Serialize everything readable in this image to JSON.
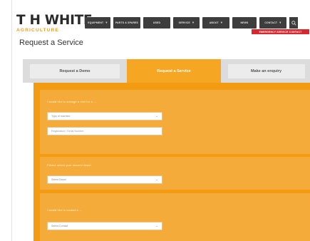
{
  "brand": {
    "name": "T H WHITE",
    "sub": "AGRICULTURE",
    "accent": "#f5a623",
    "dark": "#3d3d3d",
    "red": "#d8272f"
  },
  "nav": {
    "items": [
      {
        "label": "EQUIPMENT",
        "caret": "▾"
      },
      {
        "label": "PARTS & SPARES",
        "caret": ""
      },
      {
        "label": "USED",
        "caret": ""
      },
      {
        "label": "SERVICE",
        "caret": "▾"
      },
      {
        "label": "ABOUT",
        "caret": "▾"
      },
      {
        "label": "NEWS",
        "caret": ""
      },
      {
        "label": "CONTACT",
        "caret": "▾"
      }
    ],
    "search_icon": "search-icon",
    "emergency_label": "EMERGENCY SERVICE CONTACT"
  },
  "page": {
    "title": "Request a Service"
  },
  "tabs": [
    {
      "label": "Request a Demo"
    },
    {
      "label": "Request a Service"
    },
    {
      "label": "Make an enquiry"
    }
  ],
  "form": {
    "section1": {
      "label": "I would like to arrange a visit for a ...",
      "select_value": "Type of machine",
      "input_placeholder": "Registration / Serial Number"
    },
    "section2": {
      "label": "Please select your nearest depot",
      "select_value": "Select Depot"
    },
    "section3": {
      "label": "I would like to contact a ...",
      "select_value": "Select Contact"
    }
  }
}
